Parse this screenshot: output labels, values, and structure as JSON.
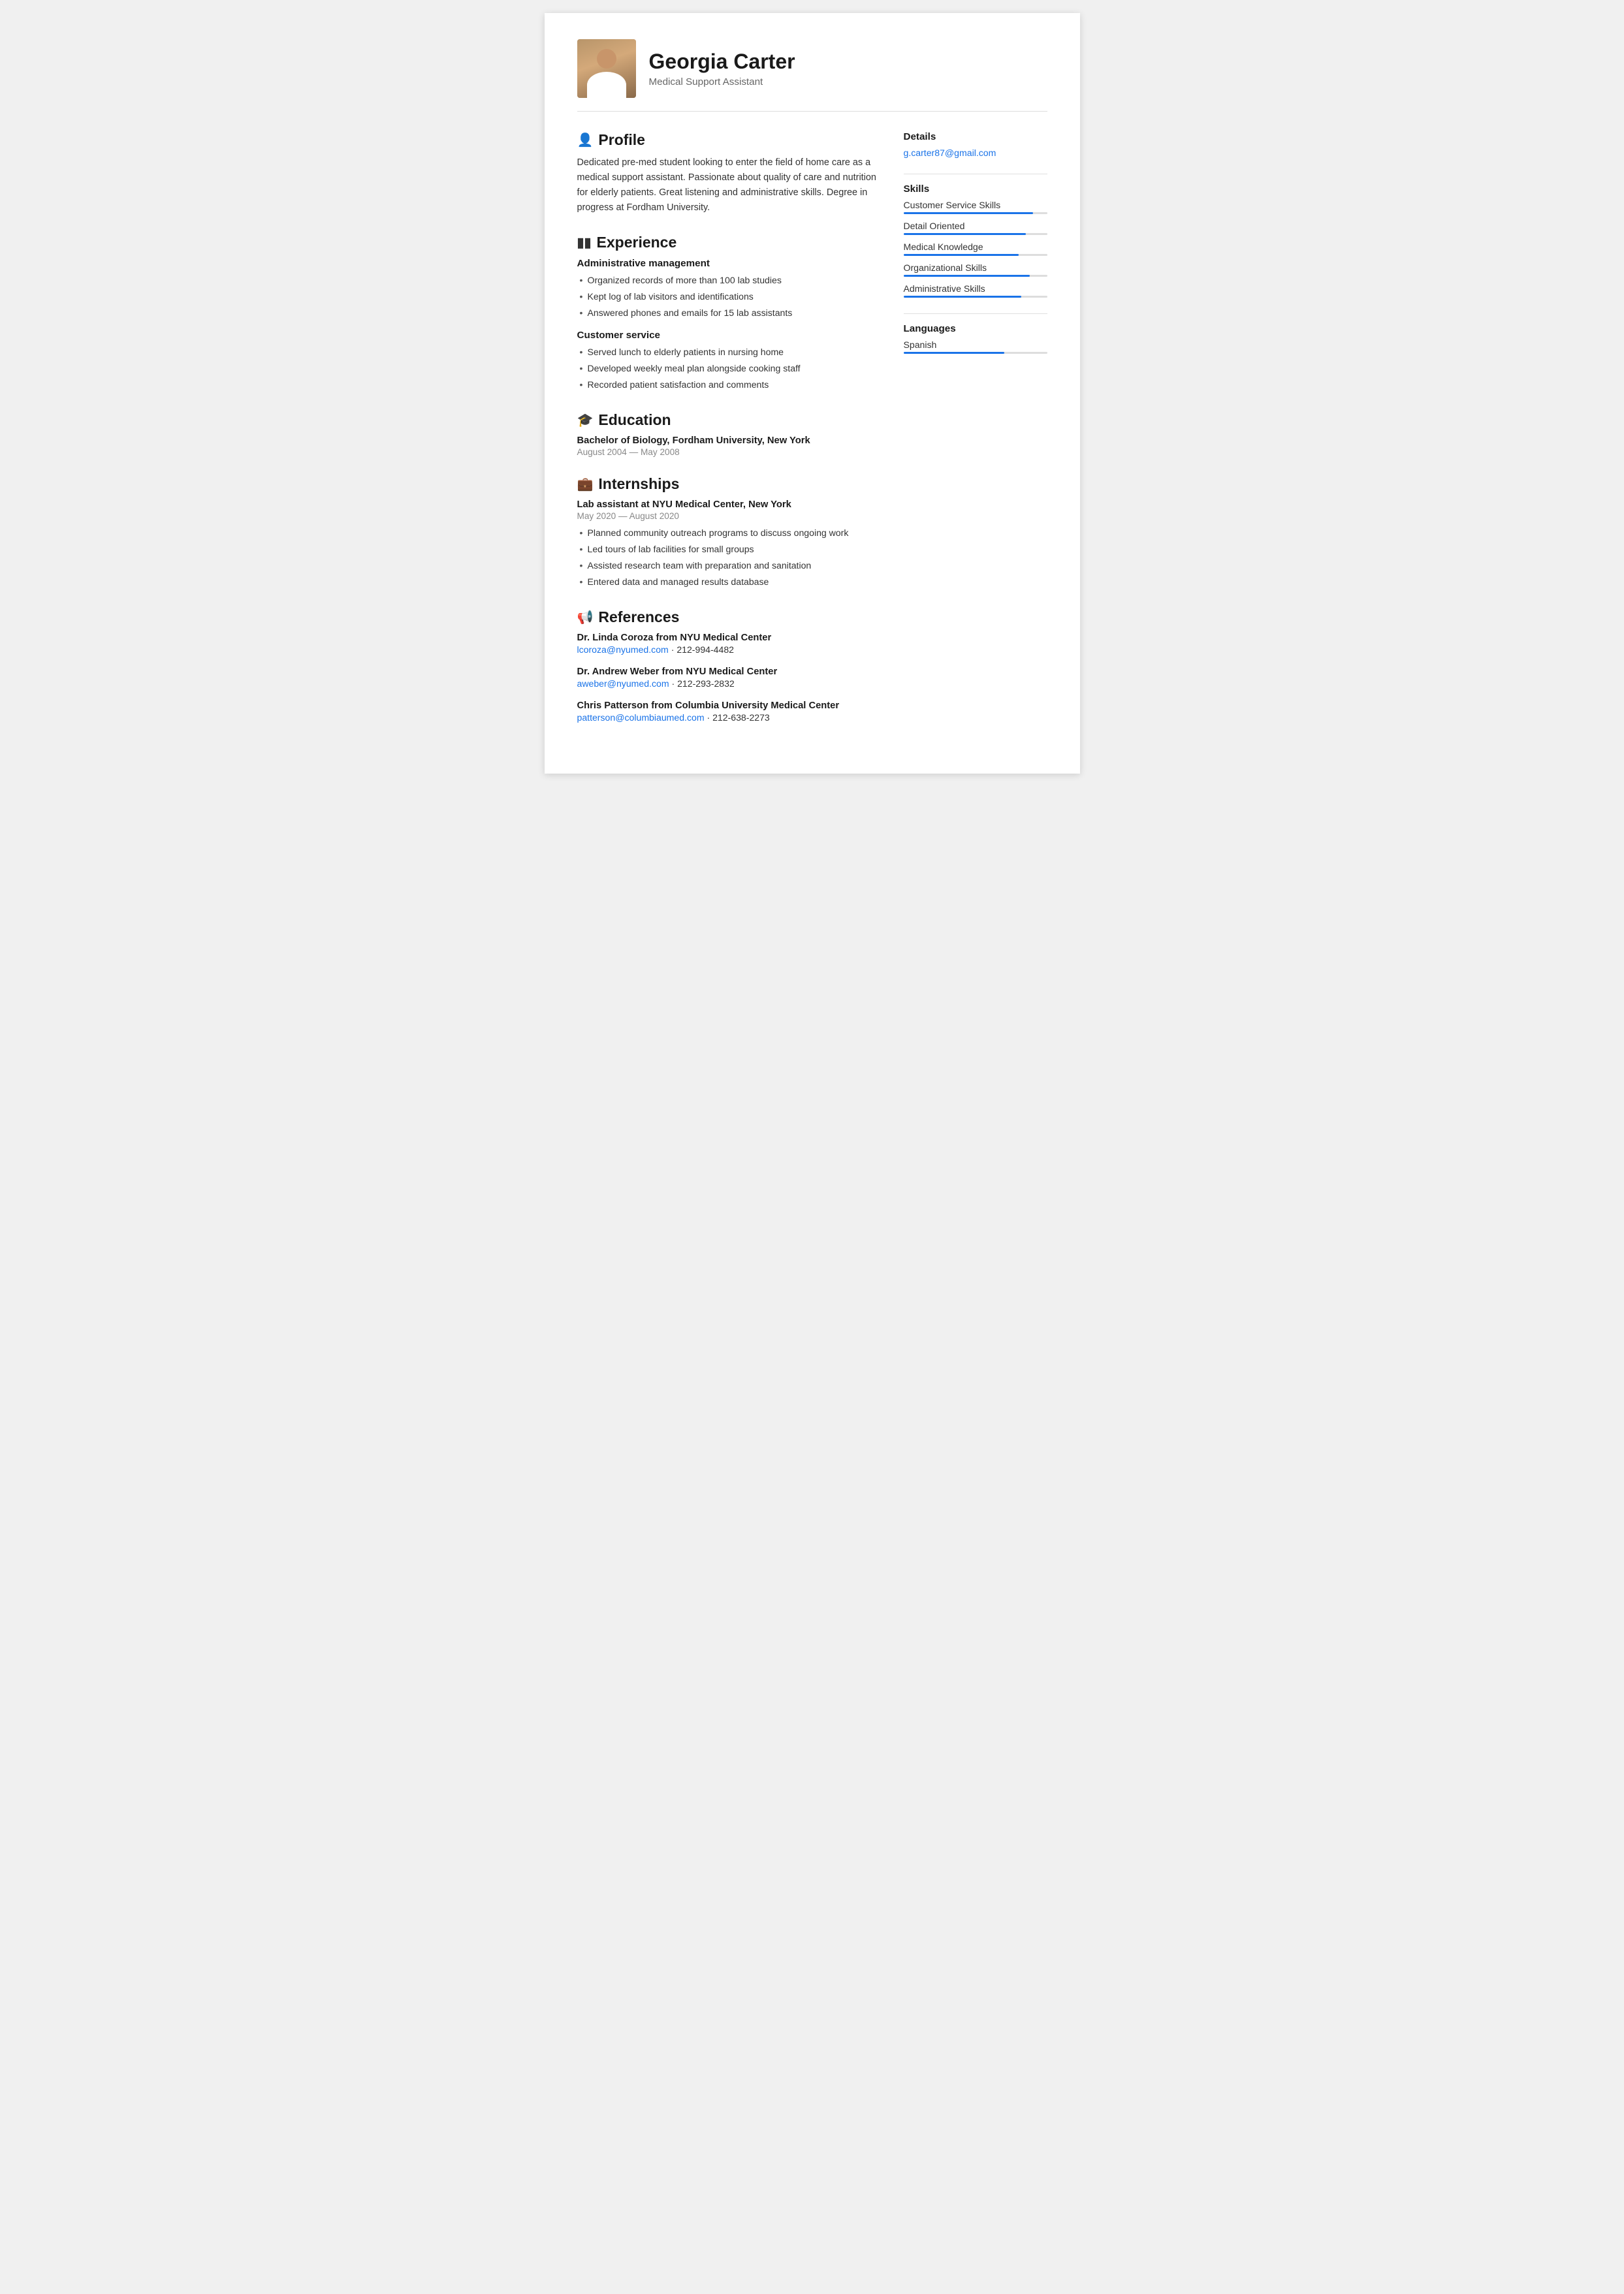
{
  "header": {
    "name": "Georgia Carter",
    "subtitle": "Medical Support Assistant",
    "avatar_alt": "Georgia Carter photo"
  },
  "details": {
    "title": "Details",
    "email": "g.carter87@gmail.com"
  },
  "skills": {
    "title": "Skills",
    "items": [
      {
        "label": "Customer Service Skills",
        "percent": 90
      },
      {
        "label": "Detail Oriented",
        "percent": 85
      },
      {
        "label": "Medical Knowledge",
        "percent": 80
      },
      {
        "label": "Organizational Skills",
        "percent": 88
      },
      {
        "label": "Administrative Skills",
        "percent": 82
      }
    ]
  },
  "languages": {
    "title": "Languages",
    "items": [
      {
        "label": "Spanish",
        "percent": 70
      }
    ]
  },
  "profile": {
    "title": "Profile",
    "text": "Dedicated pre-med student looking to enter the field of home care as a medical support assistant. Passionate about quality of care and nutrition for elderly patients. Great listening and administrative skills. Degree in progress at Fordham University."
  },
  "experience": {
    "title": "Experience",
    "roles": [
      {
        "title": "Administrative management",
        "bullets": [
          "Organized records of more than 100 lab studies",
          "Kept log of lab visitors and identifications",
          "Answered phones and emails for 15 lab assistants"
        ]
      },
      {
        "title": "Customer service",
        "bullets": [
          "Served lunch to elderly patients in nursing home",
          "Developed weekly meal plan alongside cooking staff",
          "Recorded patient satisfaction and comments"
        ]
      }
    ]
  },
  "education": {
    "title": "Education",
    "degree": "Bachelor of Biology, Fordham University, New York",
    "dates": "August 2004 — May 2008"
  },
  "internships": {
    "title": "Internships",
    "title_role": "Lab assistant at NYU Medical Center, New York",
    "dates": "May 2020 — August 2020",
    "bullets": [
      "Planned community outreach programs to discuss ongoing work",
      "Led tours of lab facilities for small groups",
      "Assisted research team with preparation and sanitation",
      "Entered data and managed results database"
    ]
  },
  "references": {
    "title": "References",
    "items": [
      {
        "name": "Dr. Linda Coroza from NYU Medical Center",
        "email": "lcoroza@nyumed.com",
        "phone": "212-994-4482"
      },
      {
        "name": "Dr. Andrew Weber from NYU Medical Center",
        "email": "aweber@nyumed.com",
        "phone": "212-293-2832"
      },
      {
        "name": "Chris Patterson from Columbia University Medical Center",
        "email": "patterson@columbiaumed.com",
        "phone": "212-638-2273"
      }
    ]
  }
}
